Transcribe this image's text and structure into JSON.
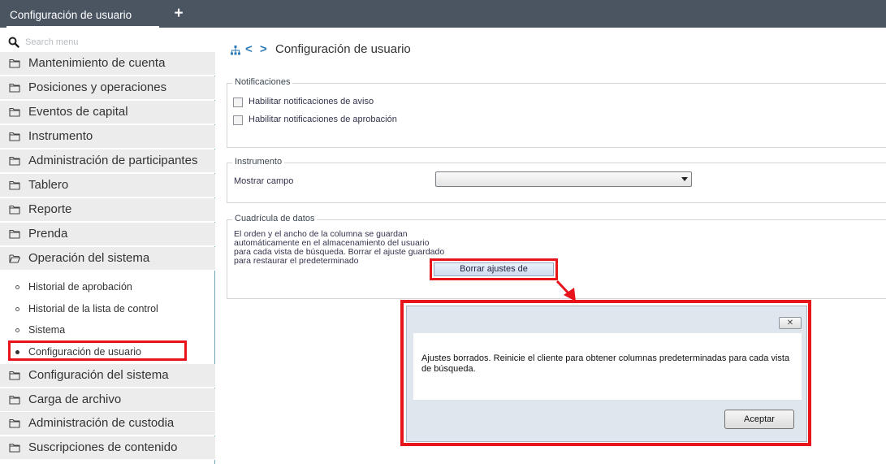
{
  "tabbar": {
    "active_tab": "Configuración de usuario",
    "add_tab_glyph": "+"
  },
  "sidebar": {
    "search_placeholder": "Search menu",
    "items": [
      {
        "label": "Mantenimiento de cuenta",
        "icon": "folder-icon"
      },
      {
        "label": "Posiciones y operaciones",
        "icon": "folder-icon"
      },
      {
        "label": "Eventos de capital",
        "icon": "folder-icon"
      },
      {
        "label": "Instrumento",
        "icon": "folder-icon"
      },
      {
        "label": "Administración de participantes",
        "icon": "folder-icon"
      },
      {
        "label": "Tablero",
        "icon": "folder-icon"
      },
      {
        "label": "Reporte",
        "icon": "folder-icon"
      },
      {
        "label": "Prenda",
        "icon": "folder-icon"
      },
      {
        "label": "Operación del sistema",
        "icon": "folder-open-icon"
      }
    ],
    "subitems": [
      {
        "label": "Historial de aprobación",
        "selected": false
      },
      {
        "label": "Historial de la lista de control",
        "selected": false
      },
      {
        "label": "Sistema",
        "selected": false
      },
      {
        "label": "Configuración de usuario",
        "selected": true
      }
    ],
    "items_after": [
      {
        "label": "Configuración del sistema",
        "icon": "folder-icon"
      },
      {
        "label": "Carga de archivo",
        "icon": "folder-icon"
      },
      {
        "label": "Administración de custodia",
        "icon": "folder-icon"
      },
      {
        "label": "Suscripciones de contenido",
        "icon": "folder-icon"
      }
    ]
  },
  "header": {
    "title": "Configuración de usuario",
    "prev_glyph": "<",
    "next_glyph": ">"
  },
  "notificaciones": {
    "legend": "Notificaciones",
    "options": [
      {
        "label": "Habilitar notificaciones de aviso",
        "checked": false
      },
      {
        "label": "Habilitar notificaciones de aprobación",
        "checked": false
      }
    ]
  },
  "instrumento": {
    "legend": "Instrumento",
    "field_label": "Mostrar campo",
    "select_value": ""
  },
  "cuadricula": {
    "legend": "Cuadrícula de datos",
    "description": "El orden y el ancho de la columna se guardan automáticamente en el almacenamiento del usuario para cada vista de búsqueda. Borrar el ajuste guardado para restaurar el predeterminado",
    "clear_button": "Borrar ajustes de"
  },
  "dialog": {
    "close_glyph": "✕",
    "message": "Ajustes borrados. Reinicie el cliente para obtener columnas predeterminadas para cada vista de búsqueda.",
    "ok_button": "Aceptar"
  },
  "colors": {
    "topbar": "#4a5561",
    "annotation_red": "#e8141b",
    "link_blue": "#2e7bb5"
  }
}
